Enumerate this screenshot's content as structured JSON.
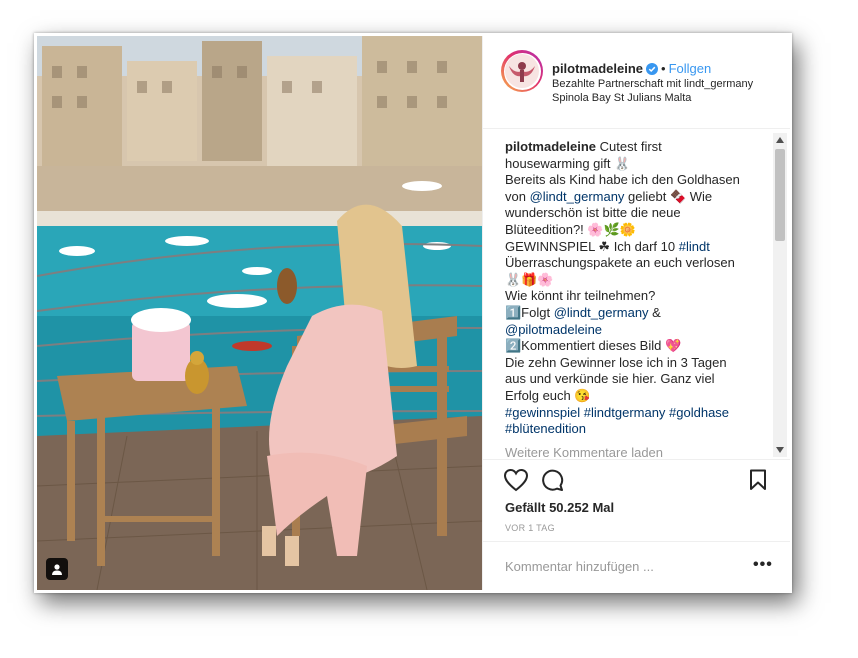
{
  "post": {
    "username": "pilotmadeleine",
    "follow_label": "Follgen",
    "dot": "•",
    "partnership": "Bezahlte Partnerschaft mit lindt_germany",
    "location": "Spinola Bay St Julians Malta",
    "caption": {
      "author": "pilotmadeleine",
      "l1": "Cutest first",
      "l2": "housewarming gift 🐰",
      "l3": "Bereits als Kind habe ich den Goldhasen",
      "l4_pre": "von ",
      "l4_mention": "@lindt_germany",
      "l4_post": " geliebt 🍫 Wie",
      "l5": "wunderschön ist bitte die neue",
      "l6": "Blüteedition?! 🌸🌿🌼",
      "l7_pre": "GEWINNSPIEL ☘ Ich darf 10 ",
      "l7_tag": "#lindt",
      "l8": "Überraschungspakete an euch verlosen",
      "l9": "🐰🎁🌸",
      "l10": "Wie könnt ihr teilnehmen?",
      "l11_pre": "1️⃣Folgt ",
      "l11_mention": "@lindt_germany",
      "l11_post": " &",
      "l12_mention": "@pilotmadeleine",
      "l13": "2️⃣Kommentiert dieses Bild 💖",
      "l14": "Die zehn Gewinner lose ich in 3 Tagen",
      "l15": "aus und verkünde sie hier. Ganz viel",
      "l16": "Erfolg euch 😘",
      "l17": "#gewinnspiel #lindtgermany #goldhase",
      "l18": "#blütenedition"
    },
    "load_more": "Weitere Kommentare laden",
    "likes": "Gefällt 50.252 Mal",
    "time": "VOR 1 TAG",
    "comment_placeholder": "Kommentar hinzufügen ...",
    "more_label": "•••"
  },
  "icons": {
    "heart": "heart-icon",
    "comment": "comment-icon",
    "bookmark": "bookmark-icon",
    "verified": "verified-badge-icon",
    "user_tag": "user-tag-icon"
  },
  "colors": {
    "link": "#003569",
    "follow": "#3897f0",
    "muted": "#999999",
    "sea": "#2aa6b8"
  }
}
